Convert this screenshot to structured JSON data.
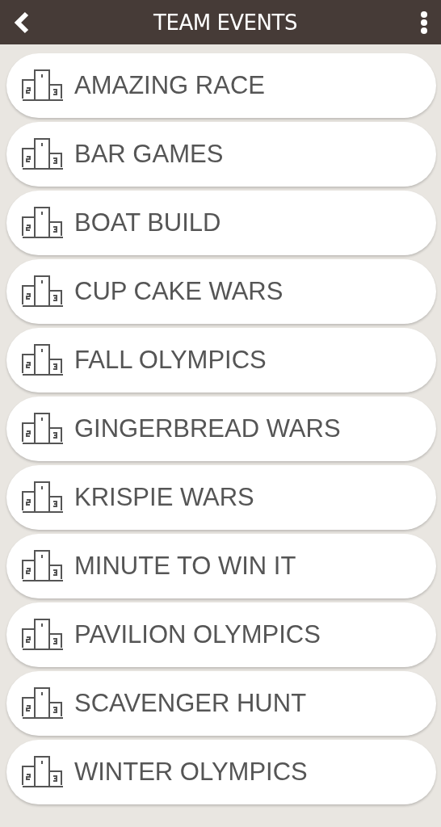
{
  "header": {
    "title": "TEAM EVENTS"
  },
  "events": [
    {
      "label": "AMAZING RACE"
    },
    {
      "label": "BAR GAMES"
    },
    {
      "label": "BOAT BUILD"
    },
    {
      "label": "CUP CAKE WARS"
    },
    {
      "label": "FALL OLYMPICS"
    },
    {
      "label": "GINGERBREAD WARS"
    },
    {
      "label": "KRISPIE WARS"
    },
    {
      "label": "MINUTE TO WIN IT"
    },
    {
      "label": "PAVILION OLYMPICS"
    },
    {
      "label": "SCAVENGER HUNT"
    },
    {
      "label": "WINTER OLYMPICS"
    }
  ]
}
